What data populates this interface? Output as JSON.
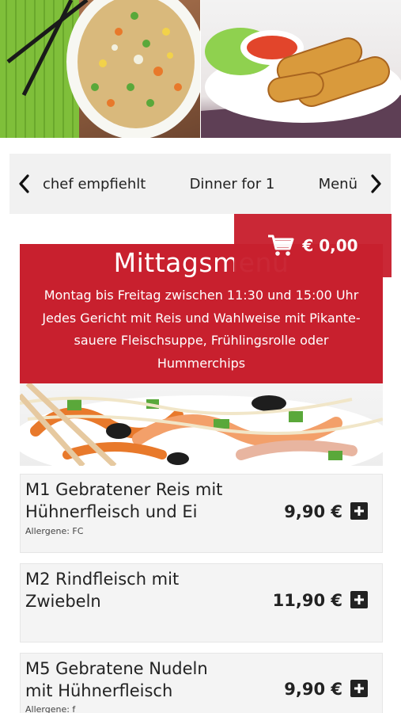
{
  "hero": {
    "left_image": "fried-rice-with-chopsticks",
    "right_image": "spring-rolls-with-dip"
  },
  "nav": {
    "prev_icon": "chevron-left-icon",
    "next_icon": "chevron-right-icon",
    "items": [
      "chef empfiehlt",
      "Dinner for 1",
      "Menü"
    ]
  },
  "cart": {
    "icon": "cart-icon",
    "amount": "€ 0,00"
  },
  "section": {
    "title": "Mittagsmenu",
    "desc_lines": [
      "Montag bis Freitag zwischen 11:30 und 15:00 Uhr",
      "Jedes Gericht mit Reis und Wahlweise mit Pikante-",
      "sauere Fleischsuppe, Frühlingsrolle oder",
      "Hummerchips"
    ]
  },
  "items": [
    {
      "name_lines": [
        "M1 Gebratener Reis mit",
        "Hühnerfleisch und Ei"
      ],
      "price": "9,90 €",
      "allergen": "Allergene: FC"
    },
    {
      "name_lines": [
        "M2 Rindfleisch mit",
        "Zwiebeln"
      ],
      "price": "11,90 €",
      "allergen": ""
    },
    {
      "name_lines": [
        "M5 Gebratene Nudeln",
        "mit Hühnerfleisch"
      ],
      "price": "9,90 €",
      "allergen": "Allergene: f"
    }
  ],
  "colors": {
    "accent": "#c8202e",
    "card": "#f4f4f4",
    "nav_bg": "#f1f1f1"
  }
}
